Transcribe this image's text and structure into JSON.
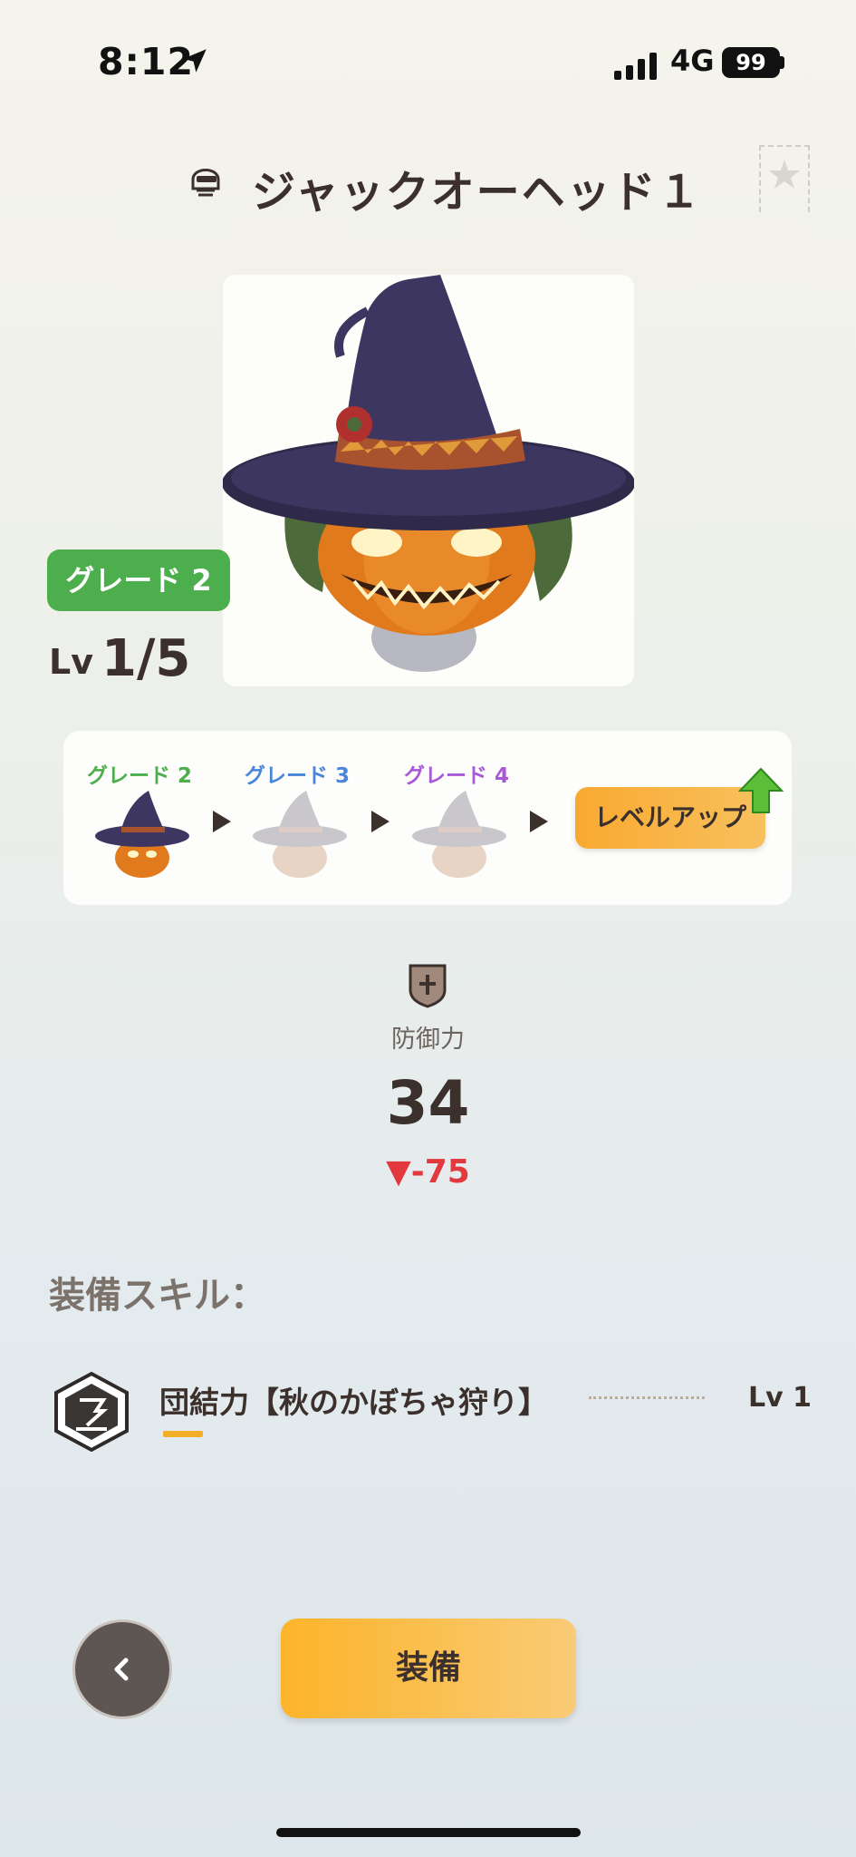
{
  "status_bar": {
    "time": "8:12",
    "network": "4G",
    "battery": "99"
  },
  "header": {
    "title": "ジャックオーヘッド１"
  },
  "item": {
    "grade_label": "グレード 2",
    "level_prefix": "Lv",
    "level_value": "1/5"
  },
  "upgrade": {
    "stages": [
      {
        "label": "グレード 2",
        "color": "#4cae4c"
      },
      {
        "label": "グレード 3",
        "color": "#4a86d8"
      },
      {
        "label": "グレード 4",
        "color": "#a859d6"
      }
    ],
    "level_up_label": "レベルアップ"
  },
  "stat": {
    "label": "防御力",
    "value": "34",
    "change": "▼-75"
  },
  "skills": {
    "heading": "装備スキル：",
    "items": [
      {
        "name": "団結力【秋のかぼちゃ狩り】",
        "level": "Lv 1"
      }
    ]
  },
  "actions": {
    "equip_label": "装備"
  },
  "colors": {
    "accent": "#f9b22e",
    "grade_green": "#4cae4c",
    "decrease_red": "#e2393e"
  }
}
